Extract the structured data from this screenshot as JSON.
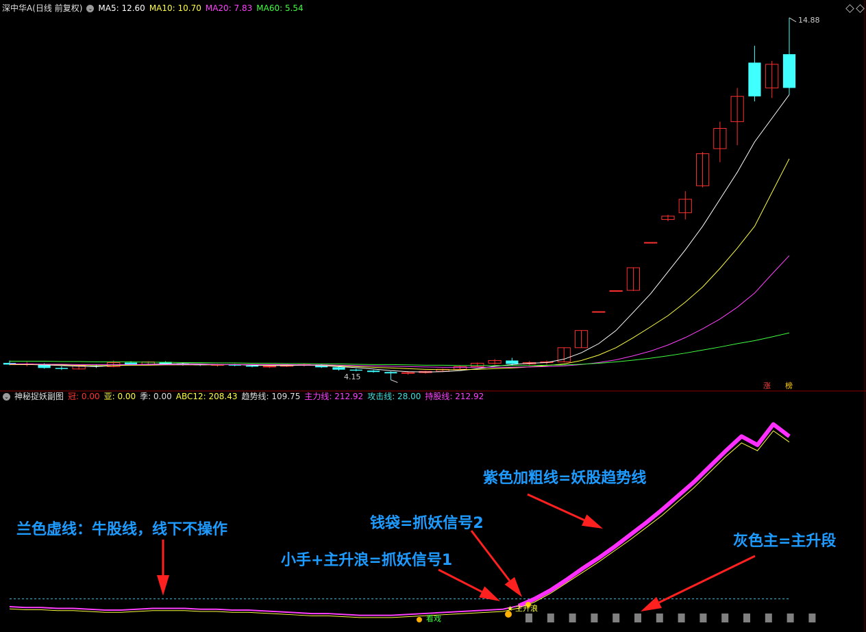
{
  "main_panel": {
    "title": "深中华A(日线 前复权)",
    "indicators": [
      {
        "label": "MA5",
        "value": "12.60",
        "color": "#ffffff"
      },
      {
        "label": "MA10",
        "value": "10.70",
        "color": "#ffff40"
      },
      {
        "label": "MA20",
        "value": "7.83",
        "color": "#ff40ff"
      },
      {
        "label": "MA60",
        "value": "5.54",
        "color": "#40ff40"
      }
    ],
    "high_label": "14.88",
    "low_label": "4.15",
    "badges": [
      {
        "text": "涨",
        "color": "#ff4040"
      },
      {
        "text": "榜",
        "color": "#ffcc00"
      }
    ]
  },
  "sub_panel": {
    "title": "神秘捉妖副图",
    "indicators": [
      {
        "label": "冠",
        "value": "0.00",
        "color": "#ff3030"
      },
      {
        "label": "亚",
        "value": "0.00",
        "color": "#ffff40"
      },
      {
        "label": "季",
        "value": "0.00",
        "color": "#e0e0e0"
      },
      {
        "label": "ABC12",
        "value": "208.43",
        "color": "#ffff40"
      },
      {
        "label": "趋势线",
        "value": "109.75",
        "color": "#e0e0e0"
      },
      {
        "label": "主力线",
        "value": "212.92",
        "color": "#ff40ff"
      },
      {
        "label": "攻击线",
        "value": "28.00",
        "color": "#40e0e0"
      },
      {
        "label": "持股线",
        "value": "212.92",
        "color": "#ff40ff"
      }
    ],
    "chart_labels": {
      "kanxi": "看戏",
      "zhushenglang": "主升浪"
    }
  },
  "annotations": [
    {
      "id": "a1",
      "text": "紫色加粗线=妖股趋势线"
    },
    {
      "id": "a2",
      "text": "兰色虚线：牛股线，线下不操作"
    },
    {
      "id": "a3",
      "text": "钱袋=抓妖信号2"
    },
    {
      "id": "a4",
      "text": "灰色主=主升段"
    },
    {
      "id": "a5",
      "text": "小手+主升浪=抓妖信号1"
    }
  ],
  "colors": {
    "up": "#ff3030",
    "down": "#40ffff",
    "bg": "#000000",
    "annotation": "#1e9bff",
    "divider": "#8b0000"
  },
  "chart_data": [
    {
      "type": "candlestick",
      "title": "深中华A(日线 前复权)",
      "ylim": [
        4.0,
        15.0
      ],
      "candles": [
        {
          "o": 4.65,
          "h": 4.72,
          "l": 4.58,
          "c": 4.6
        },
        {
          "o": 4.6,
          "h": 4.68,
          "l": 4.55,
          "c": 4.62
        },
        {
          "o": 4.62,
          "h": 4.64,
          "l": 4.48,
          "c": 4.5
        },
        {
          "o": 4.5,
          "h": 4.55,
          "l": 4.44,
          "c": 4.47
        },
        {
          "o": 4.47,
          "h": 4.58,
          "l": 4.45,
          "c": 4.56
        },
        {
          "o": 4.56,
          "h": 4.6,
          "l": 4.5,
          "c": 4.54
        },
        {
          "o": 4.54,
          "h": 4.72,
          "l": 4.52,
          "c": 4.66
        },
        {
          "o": 4.66,
          "h": 4.7,
          "l": 4.58,
          "c": 4.6
        },
        {
          "o": 4.6,
          "h": 4.7,
          "l": 4.58,
          "c": 4.68
        },
        {
          "o": 4.68,
          "h": 4.7,
          "l": 4.6,
          "c": 4.62
        },
        {
          "o": 4.62,
          "h": 4.65,
          "l": 4.57,
          "c": 4.6
        },
        {
          "o": 4.6,
          "h": 4.63,
          "l": 4.56,
          "c": 4.58
        },
        {
          "o": 4.58,
          "h": 4.62,
          "l": 4.54,
          "c": 4.6
        },
        {
          "o": 4.6,
          "h": 4.62,
          "l": 4.55,
          "c": 4.57
        },
        {
          "o": 4.57,
          "h": 4.6,
          "l": 4.52,
          "c": 4.54
        },
        {
          "o": 4.54,
          "h": 4.57,
          "l": 4.5,
          "c": 4.55
        },
        {
          "o": 4.55,
          "h": 4.6,
          "l": 4.53,
          "c": 4.58
        },
        {
          "o": 4.58,
          "h": 4.62,
          "l": 4.54,
          "c": 4.6
        },
        {
          "o": 4.6,
          "h": 4.62,
          "l": 4.5,
          "c": 4.52
        },
        {
          "o": 4.52,
          "h": 4.55,
          "l": 4.42,
          "c": 4.45
        },
        {
          "o": 4.45,
          "h": 4.48,
          "l": 4.4,
          "c": 4.42
        },
        {
          "o": 4.42,
          "h": 4.44,
          "l": 4.36,
          "c": 4.38
        },
        {
          "o": 4.38,
          "h": 4.4,
          "l": 4.15,
          "c": 4.34
        },
        {
          "o": 4.34,
          "h": 4.4,
          "l": 4.3,
          "c": 4.36
        },
        {
          "o": 4.36,
          "h": 4.42,
          "l": 4.33,
          "c": 4.4
        },
        {
          "o": 4.4,
          "h": 4.48,
          "l": 4.38,
          "c": 4.46
        },
        {
          "o": 4.46,
          "h": 4.56,
          "l": 4.44,
          "c": 4.54
        },
        {
          "o": 4.54,
          "h": 4.66,
          "l": 4.52,
          "c": 4.64
        },
        {
          "o": 4.64,
          "h": 4.76,
          "l": 4.6,
          "c": 4.72
        },
        {
          "o": 4.72,
          "h": 4.8,
          "l": 4.58,
          "c": 4.62
        },
        {
          "o": 4.62,
          "h": 4.7,
          "l": 4.58,
          "c": 4.66
        },
        {
          "o": 4.66,
          "h": 4.72,
          "l": 4.6,
          "c": 4.68
        },
        {
          "o": 4.68,
          "h": 5.1,
          "l": 4.66,
          "c": 5.1
        },
        {
          "o": 5.1,
          "h": 5.61,
          "l": 5.1,
          "c": 5.61
        },
        {
          "o": 6.17,
          "h": 6.17,
          "l": 6.17,
          "c": 6.17
        },
        {
          "o": 6.79,
          "h": 6.79,
          "l": 6.79,
          "c": 6.79
        },
        {
          "o": 6.8,
          "h": 7.47,
          "l": 6.78,
          "c": 7.47
        },
        {
          "o": 8.22,
          "h": 8.22,
          "l": 8.22,
          "c": 8.22
        },
        {
          "o": 8.9,
          "h": 9.04,
          "l": 8.85,
          "c": 9.0
        },
        {
          "o": 9.1,
          "h": 9.74,
          "l": 8.9,
          "c": 9.5
        },
        {
          "o": 9.9,
          "h": 10.9,
          "l": 9.85,
          "c": 10.85
        },
        {
          "o": 11.0,
          "h": 11.8,
          "l": 10.6,
          "c": 11.6
        },
        {
          "o": 11.8,
          "h": 12.8,
          "l": 11.1,
          "c": 12.55
        },
        {
          "o": 13.55,
          "h": 14.05,
          "l": 12.4,
          "c": 12.55
        },
        {
          "o": 12.8,
          "h": 13.6,
          "l": 12.5,
          "c": 13.5
        },
        {
          "o": 13.8,
          "h": 14.88,
          "l": 12.6,
          "c": 12.8
        }
      ],
      "ma": {
        "MA5": [
          4.6,
          4.6,
          4.59,
          4.57,
          4.55,
          4.54,
          4.57,
          4.59,
          4.61,
          4.62,
          4.63,
          4.62,
          4.6,
          4.6,
          4.58,
          4.57,
          4.57,
          4.58,
          4.57,
          4.54,
          4.51,
          4.47,
          4.42,
          4.39,
          4.38,
          4.39,
          4.42,
          4.48,
          4.55,
          4.6,
          4.64,
          4.66,
          4.76,
          4.95,
          5.22,
          5.61,
          6.15,
          6.7,
          7.35,
          8.0,
          8.7,
          9.5,
          10.3,
          11.2,
          11.9,
          12.6
        ],
        "MA10": [
          4.6,
          4.6,
          4.6,
          4.59,
          4.58,
          4.57,
          4.57,
          4.58,
          4.58,
          4.59,
          4.59,
          4.59,
          4.59,
          4.6,
          4.6,
          4.59,
          4.59,
          4.59,
          4.58,
          4.56,
          4.54,
          4.52,
          4.5,
          4.48,
          4.46,
          4.45,
          4.45,
          4.46,
          4.48,
          4.5,
          4.53,
          4.57,
          4.62,
          4.72,
          4.88,
          5.1,
          5.4,
          5.72,
          6.05,
          6.45,
          6.9,
          7.45,
          8.05,
          8.7,
          9.7,
          10.7
        ],
        "MA20": [
          4.62,
          4.62,
          4.61,
          4.61,
          4.6,
          4.6,
          4.6,
          4.6,
          4.6,
          4.6,
          4.6,
          4.6,
          4.6,
          4.6,
          4.6,
          4.6,
          4.6,
          4.59,
          4.59,
          4.58,
          4.57,
          4.56,
          4.55,
          4.54,
          4.53,
          4.52,
          4.52,
          4.52,
          4.52,
          4.52,
          4.53,
          4.54,
          4.56,
          4.6,
          4.66,
          4.74,
          4.86,
          5.0,
          5.18,
          5.4,
          5.66,
          5.95,
          6.3,
          6.72,
          7.28,
          7.83
        ],
        "MA60": [
          4.7,
          4.7,
          4.7,
          4.69,
          4.69,
          4.68,
          4.68,
          4.68,
          4.67,
          4.67,
          4.66,
          4.66,
          4.65,
          4.65,
          4.64,
          4.64,
          4.63,
          4.63,
          4.62,
          4.62,
          4.61,
          4.6,
          4.6,
          4.59,
          4.58,
          4.58,
          4.57,
          4.57,
          4.57,
          4.57,
          4.57,
          4.58,
          4.59,
          4.61,
          4.64,
          4.68,
          4.73,
          4.79,
          4.86,
          4.94,
          5.03,
          5.12,
          5.22,
          5.31,
          5.42,
          5.54
        ]
      }
    },
    {
      "type": "line",
      "title": "神秘捉妖副图",
      "ylim": [
        0,
        240
      ],
      "bull_line": 32,
      "series": [
        {
          "name": "趋势线",
          "values": [
            22,
            21,
            21,
            20,
            20,
            19,
            18,
            18,
            19,
            20,
            20,
            20,
            19,
            19,
            18,
            18,
            17,
            16,
            15,
            14,
            14,
            13,
            12,
            12,
            12,
            13,
            14,
            15,
            16,
            17,
            18,
            19,
            23,
            30,
            40,
            52,
            64,
            76,
            89,
            102,
            116,
            130,
            146,
            162,
            180,
            198,
            214,
            205,
            228,
            215
          ]
        },
        {
          "name": "主力线",
          "values": [
            23,
            22,
            22,
            21,
            21,
            20,
            19,
            19,
            20,
            21,
            21,
            21,
            20,
            20,
            19,
            19,
            18,
            17,
            16,
            15,
            15,
            14,
            13,
            13,
            13,
            14,
            15,
            16,
            17,
            18,
            19,
            20,
            24,
            32,
            42,
            54,
            67,
            79,
            92,
            106,
            120,
            135,
            151,
            167,
            185,
            203,
            220,
            210,
            234,
            220
          ]
        }
      ],
      "signals": {
        "main_rise_blocks": [
          33,
          34,
          35,
          36,
          37,
          38,
          39,
          40,
          41,
          42,
          43,
          44,
          45,
          46
        ],
        "hand_index": 32,
        "bag_index": 33
      }
    }
  ]
}
